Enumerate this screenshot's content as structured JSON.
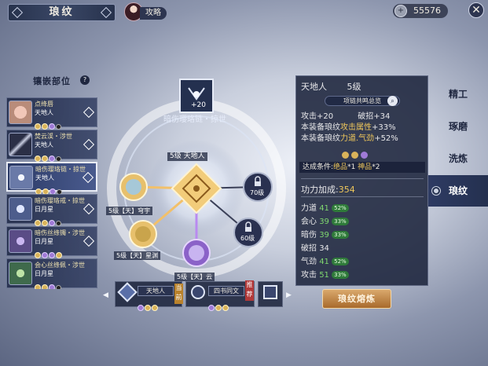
{
  "header": {
    "title": "琅纹",
    "guide_label": "攻略",
    "currency_value": "55576",
    "close_icon": "close-icon"
  },
  "left": {
    "heading": "镶嵌部位",
    "slots": [
      {
        "name": "点绛唇",
        "sub": "天地人"
      },
      {
        "name": "焚云渓・涉世",
        "sub": "天地人"
      },
      {
        "name": "暗伤璎珞链・掠世",
        "sub": "天地人"
      },
      {
        "name": "暗伤璎珞戒・掠世",
        "sub": "日月星"
      },
      {
        "name": "暗伤丝绦镯・涉世",
        "sub": "日月星"
      },
      {
        "name": "会心丝绦佩・涉世",
        "sub": "日月星"
      }
    ]
  },
  "center": {
    "item_level": "+20",
    "item_title": "暗伤璎珞链・掠世",
    "core_label": "5级 天地人",
    "node_left_top": "5级【天】穹宇",
    "node_left_bottom": "5级【天】星渊",
    "node_bottom": "5级【天】云",
    "lock1": "70级",
    "lock2": "60级"
  },
  "bottom": {
    "card1_name": "天地人",
    "card1_tag": "当前",
    "card2_name": "四书同文",
    "card2_tag": "推荐"
  },
  "detail": {
    "name": "天地人",
    "level": "5级",
    "link_btn": "项链共鸣总览",
    "attack": "攻击+20",
    "break": "破招+34",
    "line1_a": "本装备琅纹",
    "line1_b": "攻击属性",
    "line1_c": "+33%",
    "line2_a": "本装备琅纹",
    "line2_b": "力道.气劲",
    "line2_c": "+52%",
    "cond_a": "达成条件:",
    "cond_b": "绝品",
    "cond_c": "*1",
    "cond_d": "神品",
    "cond_e": "*2",
    "power_label": "功力加成:",
    "power_value": "354",
    "stats": [
      {
        "name": "力道",
        "value": "41",
        "badge": "52%"
      },
      {
        "name": "会心",
        "value": "39",
        "badge": "33%"
      },
      {
        "name": "暗伤",
        "value": "39",
        "badge": "33%"
      },
      {
        "name": "破招",
        "value": "34",
        "badge": ""
      },
      {
        "name": "气劲",
        "value": "41",
        "badge": "52%"
      },
      {
        "name": "攻击",
        "value": "51",
        "badge": "33%"
      }
    ]
  },
  "tabs": [
    "精工",
    "琢磨",
    "洗炼",
    "琅纹"
  ],
  "forge_button": "琅纹熔炼",
  "colors": {
    "gold": "#efc75b",
    "panel": "#1c2440",
    "accent_purple": "#a884e0"
  }
}
